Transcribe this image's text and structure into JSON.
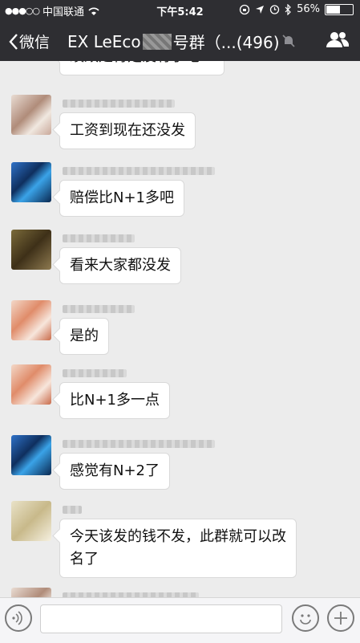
{
  "status_bar": {
    "carrier": "中国联通",
    "time": "下午5:42",
    "battery_percent": "56%",
    "battery_level": 0.56
  },
  "nav": {
    "back_label": "微信",
    "title_prefix": "EX LeEco",
    "title_suffix": "号群（...(496)"
  },
  "messages": [
    {
      "text": "绩效是肯定没有了吧？"
    },
    {
      "text": "工资到现在还没发"
    },
    {
      "text": "赔偿比N+1多吧"
    },
    {
      "text": "看来大家都没发"
    },
    {
      "text": "是的"
    },
    {
      "text": "比N+1多一点"
    },
    {
      "text": "感觉有N+2了"
    },
    {
      "text": "今天该发的钱不发，此群就可以改名了"
    }
  ],
  "icons": {
    "back": "chevron-left-icon",
    "mute": "mute-bell-icon",
    "members": "group-members-icon",
    "voice": "voice-icon",
    "emoji": "emoji-icon",
    "plus": "plus-icon"
  }
}
